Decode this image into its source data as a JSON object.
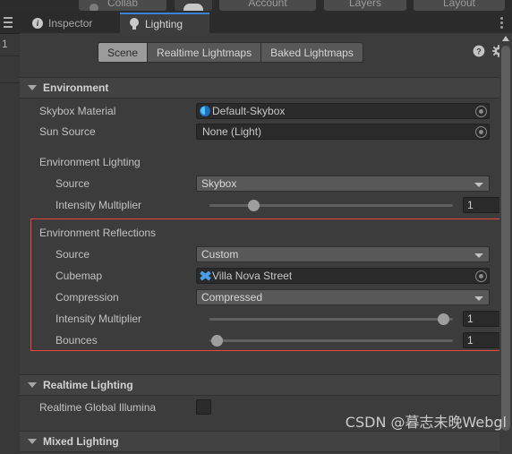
{
  "topbar": {
    "buttons": [
      {
        "label": "Collab",
        "icon": "collab-cloud-icon"
      },
      {
        "label": "",
        "icon": "cloud-icon"
      },
      {
        "label": "Account",
        "icon": ""
      },
      {
        "label": "Layers",
        "icon": ""
      },
      {
        "label": "Layout",
        "icon": ""
      }
    ]
  },
  "left_strip": {
    "menu_icon": "hamburger-menu-icon",
    "number": "1"
  },
  "editor_tabs": [
    {
      "label": "Inspector",
      "icon": "info-icon",
      "active": false
    },
    {
      "label": "Lighting",
      "icon": "lightbulb-icon",
      "active": true
    }
  ],
  "window_menu_icon": "kebab-menu-icon",
  "lighting_tabs": [
    {
      "label": "Scene",
      "active": true
    },
    {
      "label": "Realtime Lightmaps",
      "active": false
    },
    {
      "label": "Baked Lightmaps",
      "active": false
    }
  ],
  "toolbar_icons": [
    {
      "name": "help-icon",
      "glyph": "?"
    },
    {
      "name": "settings-gear-icon",
      "glyph": "gear"
    }
  ],
  "sections": {
    "environment": {
      "title": "Environment",
      "skybox_material": {
        "label": "Skybox Material",
        "value": "Default-Skybox",
        "icon": "material-sphere-icon"
      },
      "sun_source": {
        "label": "Sun Source",
        "value": "None (Light)"
      },
      "environment_lighting": {
        "group_label": "Environment Lighting",
        "source": {
          "label": "Source",
          "value": "Skybox"
        },
        "intensity_multiplier": {
          "label": "Intensity Multiplier",
          "value": "1",
          "slider_percent": 18
        }
      },
      "environment_reflections": {
        "group_label": "Environment Reflections",
        "highlighted": true,
        "highlight_color": "#f4433c",
        "source": {
          "label": "Source",
          "value": "Custom"
        },
        "cubemap": {
          "label": "Cubemap",
          "value": "Villa Nova Street",
          "icon": "cubemap-icon"
        },
        "compression": {
          "label": "Compression",
          "value": "Compressed"
        },
        "intensity_multiplier": {
          "label": "Intensity Multiplier",
          "value": "1",
          "slider_percent": 96
        },
        "bounces": {
          "label": "Bounces",
          "value": "1",
          "slider_percent": 3
        }
      }
    },
    "realtime_lighting": {
      "title": "Realtime Lighting",
      "realtime_gi": {
        "label": "Realtime Global Illumina",
        "checked": false
      }
    },
    "mixed_lighting": {
      "title": "Mixed Lighting"
    }
  },
  "watermark": "CSDN @暮志未晚Webgl"
}
